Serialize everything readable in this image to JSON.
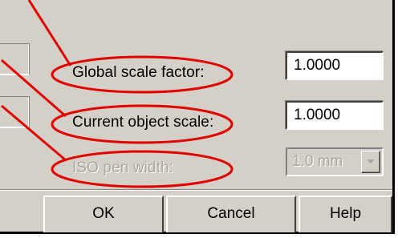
{
  "dialog": {
    "rows": [
      {
        "label": "Global scale factor:",
        "value": "1.0000",
        "enabled": true
      },
      {
        "label": "Current object scale:",
        "value": "1.0000",
        "enabled": true
      },
      {
        "label": "ISO pen width:",
        "value": "1.0 mm",
        "enabled": false
      }
    ],
    "buttons": {
      "ok": "OK",
      "cancel": "Cancel",
      "help": "Help"
    }
  },
  "annotation": {
    "color": "#e00000"
  },
  "icons": {
    "dropdown": "chevron-down-icon"
  }
}
